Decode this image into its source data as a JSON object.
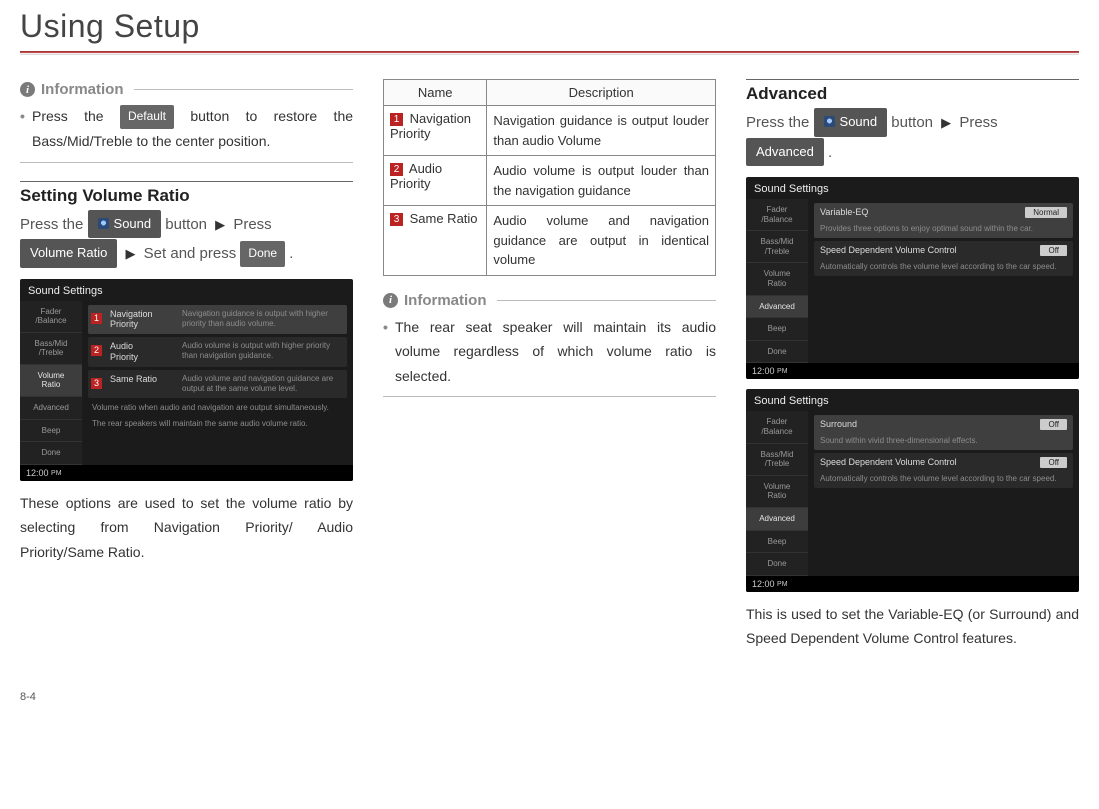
{
  "title": "Using Setup",
  "page_number": "8-4",
  "info_label": "Information",
  "arrow": "▶",
  "buttons": {
    "default": "Default",
    "sound": "Sound",
    "volume_ratio": "Volume Ratio",
    "done": "Done",
    "advanced": "Advanced"
  },
  "col1": {
    "info_text_pre": "Press the ",
    "info_text_post": " button to restore the Bass/Mid/Treble to the center position.",
    "section_heading": "Setting Volume Ratio",
    "flow_press_the": "Press the ",
    "flow_button": " button ",
    "flow_press": " Press ",
    "flow_set_and_press": " Set and press ",
    "after_para": "These options are used to set the volume ratio by selecting from Navigation Priority/ Audio Priority/Same Ratio."
  },
  "shot_common": {
    "title": "Sound Settings",
    "side_items": [
      "Fader\n/Balance",
      "Bass/Mid\n/Treble",
      "Volume\nRatio",
      "Advanced",
      "Beep",
      "Done"
    ],
    "clock": "12:00",
    "clock_suffix": "PM"
  },
  "shot1": {
    "selected_side_index": 2,
    "rows": [
      {
        "name": "Navigation\nPriority",
        "desc": "Navigation guidance is output with higher priority than audio volume.",
        "selected": true
      },
      {
        "name": "Audio\nPriority",
        "desc": "Audio volume is output with higher priority than navigation guidance."
      },
      {
        "name": "Same Ratio",
        "desc": "Audio volume and navigation guidance are output at the same volume level."
      }
    ],
    "note1": "Volume ratio when audio and navigation are output simultaneously.",
    "note2": "The rear speakers will maintain the same audio volume ratio."
  },
  "table": {
    "head_name": "Name",
    "head_desc": "Description",
    "rows": [
      {
        "num": "1",
        "name": "Navigation Priority",
        "desc": "Navigation guidance is output louder than audio Volume"
      },
      {
        "num": "2",
        "name": "Audio Priority",
        "desc": "Audio volume is output louder than the navigation guidance"
      },
      {
        "num": "3",
        "name": "Same Ratio",
        "desc": "Audio volume and navigation guidance are output in identi­cal volume"
      }
    ]
  },
  "col2": {
    "info_text": "The rear seat speaker will maintain its audio volume regardless of which volume ratio is selected."
  },
  "col3": {
    "heading": "Advanced",
    "flow_press_the": "Press the ",
    "flow_button": " button ",
    "flow_press": " Press ",
    "period": " .",
    "after_para": "This is used to set the Variable-EQ (or Surround) and Speed Dependent Volume Control features."
  },
  "shot2": {
    "selected_side_index": 3,
    "rows": [
      {
        "name": "Variable-EQ",
        "desc": "Provides three options to enjoy optimal sound within the car.",
        "value": "Normal",
        "selected": true
      },
      {
        "name": "Speed Dependent Volume Control",
        "desc": "Automatically controls the volume level according to the car speed.",
        "value": "Off"
      }
    ]
  },
  "shot3": {
    "selected_side_index": 3,
    "rows": [
      {
        "name": "Surround",
        "desc": "Sound within vivid three-dimensional effects.",
        "value": "Off",
        "selected": true
      },
      {
        "name": "Speed Dependent Volume Control",
        "desc": "Automatically controls the volume level according to the car speed.",
        "value": "Off"
      }
    ]
  }
}
